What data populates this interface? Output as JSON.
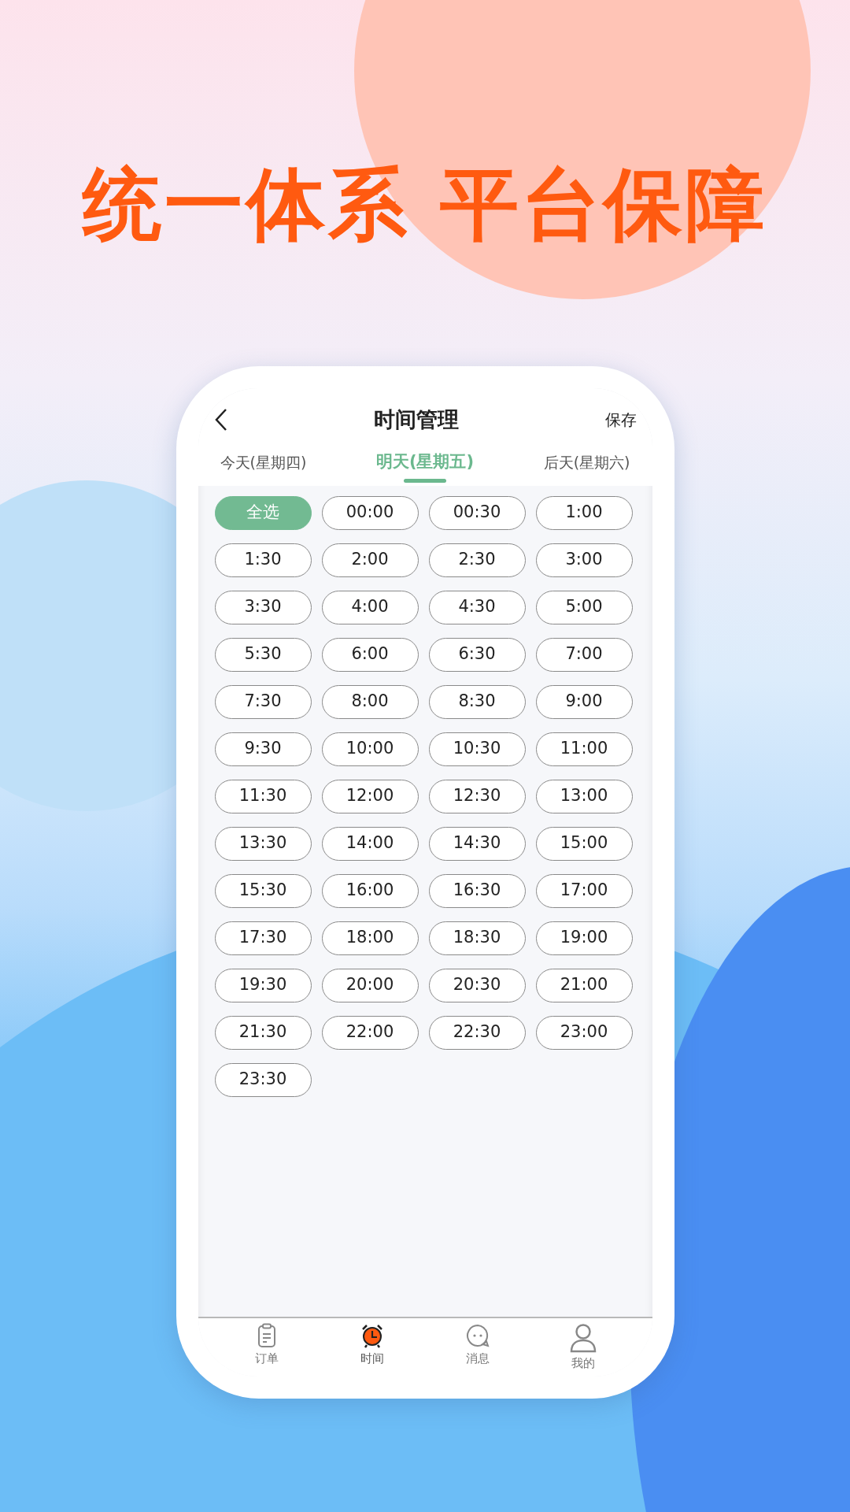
{
  "headline": "统一体系 平台保障",
  "header": {
    "title": "时间管理",
    "action": "保存"
  },
  "tabs": [
    {
      "label": "今天(星期四)",
      "selected": false
    },
    {
      "label": "明天(星期五)",
      "selected": true
    },
    {
      "label": "后天(星期六)",
      "selected": false
    }
  ],
  "slots": [
    {
      "label": "全选",
      "selected": true
    },
    {
      "label": "00:00",
      "selected": false
    },
    {
      "label": "00:30",
      "selected": false
    },
    {
      "label": "1:00",
      "selected": false
    },
    {
      "label": "1:30",
      "selected": false
    },
    {
      "label": "2:00",
      "selected": false
    },
    {
      "label": "2:30",
      "selected": false
    },
    {
      "label": "3:00",
      "selected": false
    },
    {
      "label": "3:30",
      "selected": false
    },
    {
      "label": "4:00",
      "selected": false
    },
    {
      "label": "4:30",
      "selected": false
    },
    {
      "label": "5:00",
      "selected": false
    },
    {
      "label": "5:30",
      "selected": false
    },
    {
      "label": "6:00",
      "selected": false
    },
    {
      "label": "6:30",
      "selected": false
    },
    {
      "label": "7:00",
      "selected": false
    },
    {
      "label": "7:30",
      "selected": false
    },
    {
      "label": "8:00",
      "selected": false
    },
    {
      "label": "8:30",
      "selected": false
    },
    {
      "label": "9:00",
      "selected": false
    },
    {
      "label": "9:30",
      "selected": false
    },
    {
      "label": "10:00",
      "selected": false
    },
    {
      "label": "10:30",
      "selected": false
    },
    {
      "label": "11:00",
      "selected": false
    },
    {
      "label": "11:30",
      "selected": false
    },
    {
      "label": "12:00",
      "selected": false
    },
    {
      "label": "12:30",
      "selected": false
    },
    {
      "label": "13:00",
      "selected": false
    },
    {
      "label": "13:30",
      "selected": false
    },
    {
      "label": "14:00",
      "selected": false
    },
    {
      "label": "14:30",
      "selected": false
    },
    {
      "label": "15:00",
      "selected": false
    },
    {
      "label": "15:30",
      "selected": false
    },
    {
      "label": "16:00",
      "selected": false
    },
    {
      "label": "16:30",
      "selected": false
    },
    {
      "label": "17:00",
      "selected": false
    },
    {
      "label": "17:30",
      "selected": false
    },
    {
      "label": "18:00",
      "selected": false
    },
    {
      "label": "18:30",
      "selected": false
    },
    {
      "label": "19:00",
      "selected": false
    },
    {
      "label": "19:30",
      "selected": false
    },
    {
      "label": "20:00",
      "selected": false
    },
    {
      "label": "20:30",
      "selected": false
    },
    {
      "label": "21:00",
      "selected": false
    },
    {
      "label": "21:30",
      "selected": false
    },
    {
      "label": "22:00",
      "selected": false
    },
    {
      "label": "22:30",
      "selected": false
    },
    {
      "label": "23:00",
      "selected": false
    },
    {
      "label": "23:30",
      "selected": false
    }
  ],
  "bottom_nav": [
    {
      "label": "订单",
      "kind": "orders",
      "selected": false
    },
    {
      "label": "时间",
      "kind": "time",
      "selected": true
    },
    {
      "label": "消息",
      "kind": "messages",
      "selected": false
    },
    {
      "label": "我的",
      "kind": "profile",
      "selected": false
    }
  ]
}
